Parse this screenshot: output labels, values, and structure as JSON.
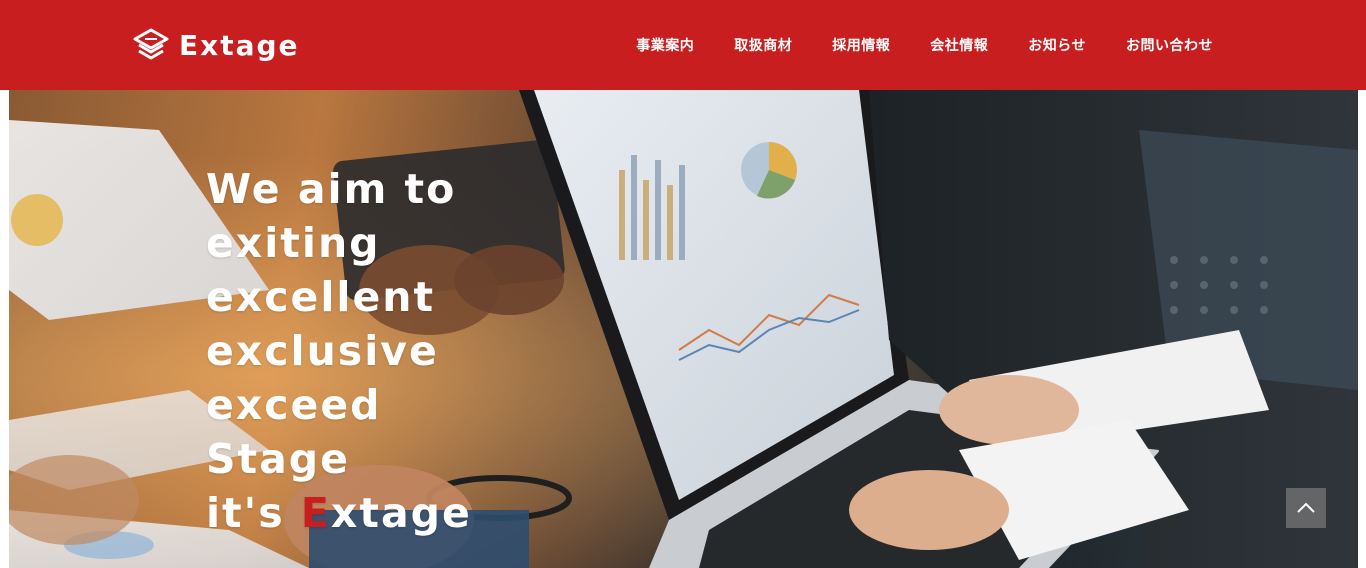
{
  "header": {
    "logo_text": "Extage",
    "logo_icon": "stacked-layers-icon",
    "accent_color": "#c81e20"
  },
  "nav": {
    "items": [
      {
        "label": "事業案内"
      },
      {
        "label": "取扱商材"
      },
      {
        "label": "採用情報"
      },
      {
        "label": "会社情報"
      },
      {
        "label": "お知らせ"
      },
      {
        "label": "お問い合わせ"
      }
    ]
  },
  "hero": {
    "lines": [
      "We aim to",
      "exiting",
      "excellent",
      "exclusive",
      "exceed",
      "Stage"
    ],
    "last_line_prefix": "it's ",
    "last_line_accent": "E",
    "last_line_suffix": "xtage"
  },
  "scroll_top": {
    "icon": "chevron-up-icon"
  }
}
